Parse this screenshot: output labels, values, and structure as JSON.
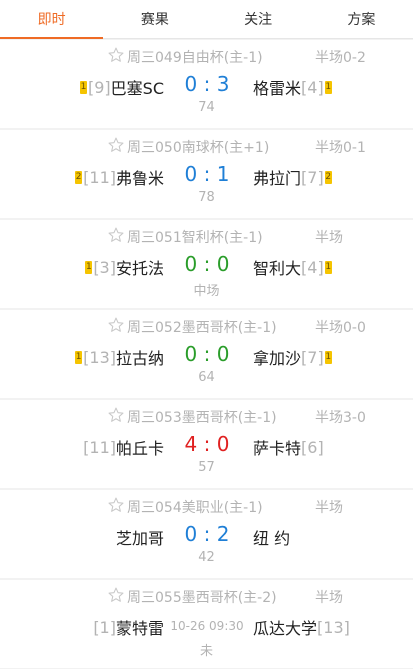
{
  "tabs": [
    {
      "label": "即时",
      "active": true
    },
    {
      "label": "赛果",
      "active": false
    },
    {
      "label": "关注",
      "active": false
    },
    {
      "label": "方案",
      "active": false
    }
  ],
  "colors": {
    "accent": "#ef6b25",
    "score_blue": "#1f7fd6",
    "score_green": "#2a9d2a",
    "score_red": "#e02020",
    "card_yellow": "#f5c400",
    "muted": "#b3b3b3"
  },
  "matches": [
    {
      "league": "周三049自由杯(主-1)",
      "half": "半场0-2",
      "home_card": "1",
      "home_rank": "[9]",
      "home": "巴塞SC",
      "score": "0 : 3",
      "score_color": "#1f7fd6",
      "away": "格雷米",
      "away_rank": "[4]",
      "away_card": "1",
      "status": "74"
    },
    {
      "league": "周三050南球杯(主+1)",
      "half": "半场0-1",
      "home_card": "2",
      "home_rank": "[11]",
      "home": "弗鲁米",
      "score": "0 : 1",
      "score_color": "#1f7fd6",
      "away": "弗拉门",
      "away_rank": "[7]",
      "away_card": "2",
      "status": "78"
    },
    {
      "league": "周三051智利杯(主-1)",
      "half": "半场",
      "home_card": "1",
      "home_rank": "[3]",
      "home": "安托法",
      "score": "0 : 0",
      "score_color": "#2a9d2a",
      "away": "智利大",
      "away_rank": "[4]",
      "away_card": "1",
      "status": "中场"
    },
    {
      "league": "周三052墨西哥杯(主-1)",
      "half": "半场0-0",
      "home_card": "1",
      "home_rank": "[13]",
      "home": "拉古纳",
      "score": "0 : 0",
      "score_color": "#2a9d2a",
      "away": "拿加沙",
      "away_rank": "[7]",
      "away_card": "1",
      "status": "64"
    },
    {
      "league": "周三053墨西哥杯(主-1)",
      "half": "半场3-0",
      "home_card": "",
      "home_rank": "[11]",
      "home": "帕丘卡",
      "score": "4 : 0",
      "score_color": "#e02020",
      "away": "萨卡特",
      "away_rank": "[6]",
      "away_card": "",
      "status": "57"
    },
    {
      "league": "周三054美职业(主-1)",
      "half": "半场",
      "home_card": "",
      "home_rank": "",
      "home": "芝加哥",
      "score": "0 : 2",
      "score_color": "#1f7fd6",
      "away": "纽 约",
      "away_rank": "",
      "away_card": "",
      "status": "42"
    },
    {
      "league": "周三055墨西哥杯(主-2)",
      "half": "半场",
      "home_card": "",
      "home_rank": "[1]",
      "home": "蒙特雷",
      "score": "10-26 09:30",
      "score_color": "#b3b3b3",
      "pre_match": true,
      "away": "瓜达大学",
      "away_rank": "[13]",
      "away_card": "",
      "status": "未"
    }
  ],
  "icons": {
    "favorite": "star-outline-icon"
  }
}
